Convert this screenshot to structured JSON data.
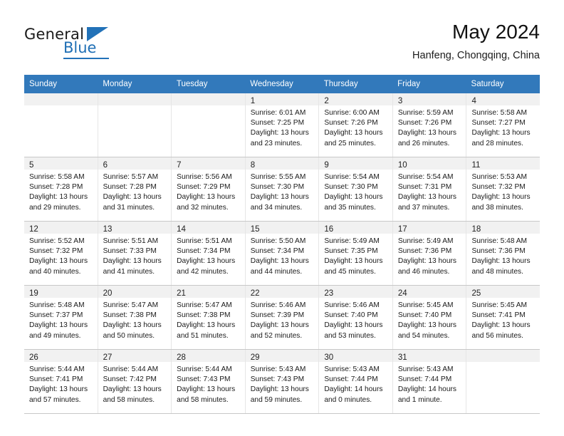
{
  "brand": {
    "name_top": "General",
    "name_bottom": "Blue",
    "accent_color": "#2272b8"
  },
  "header": {
    "title": "May 2024",
    "subtitle": "Hanfeng, Chongqing, China"
  },
  "calendar": {
    "header_bg_color": "#3279bb",
    "weekdays": [
      "Sunday",
      "Monday",
      "Tuesday",
      "Wednesday",
      "Thursday",
      "Friday",
      "Saturday"
    ],
    "weeks": [
      [
        {
          "day": "",
          "empty": true
        },
        {
          "day": "",
          "empty": true
        },
        {
          "day": "",
          "empty": true
        },
        {
          "day": "1",
          "sunrise": "Sunrise: 6:01 AM",
          "sunset": "Sunset: 7:25 PM",
          "daylight_line1": "Daylight: 13 hours",
          "daylight_line2": "and 23 minutes."
        },
        {
          "day": "2",
          "sunrise": "Sunrise: 6:00 AM",
          "sunset": "Sunset: 7:26 PM",
          "daylight_line1": "Daylight: 13 hours",
          "daylight_line2": "and 25 minutes."
        },
        {
          "day": "3",
          "sunrise": "Sunrise: 5:59 AM",
          "sunset": "Sunset: 7:26 PM",
          "daylight_line1": "Daylight: 13 hours",
          "daylight_line2": "and 26 minutes."
        },
        {
          "day": "4",
          "sunrise": "Sunrise: 5:58 AM",
          "sunset": "Sunset: 7:27 PM",
          "daylight_line1": "Daylight: 13 hours",
          "daylight_line2": "and 28 minutes."
        }
      ],
      [
        {
          "day": "5",
          "sunrise": "Sunrise: 5:58 AM",
          "sunset": "Sunset: 7:28 PM",
          "daylight_line1": "Daylight: 13 hours",
          "daylight_line2": "and 29 minutes."
        },
        {
          "day": "6",
          "sunrise": "Sunrise: 5:57 AM",
          "sunset": "Sunset: 7:28 PM",
          "daylight_line1": "Daylight: 13 hours",
          "daylight_line2": "and 31 minutes."
        },
        {
          "day": "7",
          "sunrise": "Sunrise: 5:56 AM",
          "sunset": "Sunset: 7:29 PM",
          "daylight_line1": "Daylight: 13 hours",
          "daylight_line2": "and 32 minutes."
        },
        {
          "day": "8",
          "sunrise": "Sunrise: 5:55 AM",
          "sunset": "Sunset: 7:30 PM",
          "daylight_line1": "Daylight: 13 hours",
          "daylight_line2": "and 34 minutes."
        },
        {
          "day": "9",
          "sunrise": "Sunrise: 5:54 AM",
          "sunset": "Sunset: 7:30 PM",
          "daylight_line1": "Daylight: 13 hours",
          "daylight_line2": "and 35 minutes."
        },
        {
          "day": "10",
          "sunrise": "Sunrise: 5:54 AM",
          "sunset": "Sunset: 7:31 PM",
          "daylight_line1": "Daylight: 13 hours",
          "daylight_line2": "and 37 minutes."
        },
        {
          "day": "11",
          "sunrise": "Sunrise: 5:53 AM",
          "sunset": "Sunset: 7:32 PM",
          "daylight_line1": "Daylight: 13 hours",
          "daylight_line2": "and 38 minutes."
        }
      ],
      [
        {
          "day": "12",
          "sunrise": "Sunrise: 5:52 AM",
          "sunset": "Sunset: 7:32 PM",
          "daylight_line1": "Daylight: 13 hours",
          "daylight_line2": "and 40 minutes."
        },
        {
          "day": "13",
          "sunrise": "Sunrise: 5:51 AM",
          "sunset": "Sunset: 7:33 PM",
          "daylight_line1": "Daylight: 13 hours",
          "daylight_line2": "and 41 minutes."
        },
        {
          "day": "14",
          "sunrise": "Sunrise: 5:51 AM",
          "sunset": "Sunset: 7:34 PM",
          "daylight_line1": "Daylight: 13 hours",
          "daylight_line2": "and 42 minutes."
        },
        {
          "day": "15",
          "sunrise": "Sunrise: 5:50 AM",
          "sunset": "Sunset: 7:34 PM",
          "daylight_line1": "Daylight: 13 hours",
          "daylight_line2": "and 44 minutes."
        },
        {
          "day": "16",
          "sunrise": "Sunrise: 5:49 AM",
          "sunset": "Sunset: 7:35 PM",
          "daylight_line1": "Daylight: 13 hours",
          "daylight_line2": "and 45 minutes."
        },
        {
          "day": "17",
          "sunrise": "Sunrise: 5:49 AM",
          "sunset": "Sunset: 7:36 PM",
          "daylight_line1": "Daylight: 13 hours",
          "daylight_line2": "and 46 minutes."
        },
        {
          "day": "18",
          "sunrise": "Sunrise: 5:48 AM",
          "sunset": "Sunset: 7:36 PM",
          "daylight_line1": "Daylight: 13 hours",
          "daylight_line2": "and 48 minutes."
        }
      ],
      [
        {
          "day": "19",
          "sunrise": "Sunrise: 5:48 AM",
          "sunset": "Sunset: 7:37 PM",
          "daylight_line1": "Daylight: 13 hours",
          "daylight_line2": "and 49 minutes."
        },
        {
          "day": "20",
          "sunrise": "Sunrise: 5:47 AM",
          "sunset": "Sunset: 7:38 PM",
          "daylight_line1": "Daylight: 13 hours",
          "daylight_line2": "and 50 minutes."
        },
        {
          "day": "21",
          "sunrise": "Sunrise: 5:47 AM",
          "sunset": "Sunset: 7:38 PM",
          "daylight_line1": "Daylight: 13 hours",
          "daylight_line2": "and 51 minutes."
        },
        {
          "day": "22",
          "sunrise": "Sunrise: 5:46 AM",
          "sunset": "Sunset: 7:39 PM",
          "daylight_line1": "Daylight: 13 hours",
          "daylight_line2": "and 52 minutes."
        },
        {
          "day": "23",
          "sunrise": "Sunrise: 5:46 AM",
          "sunset": "Sunset: 7:40 PM",
          "daylight_line1": "Daylight: 13 hours",
          "daylight_line2": "and 53 minutes."
        },
        {
          "day": "24",
          "sunrise": "Sunrise: 5:45 AM",
          "sunset": "Sunset: 7:40 PM",
          "daylight_line1": "Daylight: 13 hours",
          "daylight_line2": "and 54 minutes."
        },
        {
          "day": "25",
          "sunrise": "Sunrise: 5:45 AM",
          "sunset": "Sunset: 7:41 PM",
          "daylight_line1": "Daylight: 13 hours",
          "daylight_line2": "and 56 minutes."
        }
      ],
      [
        {
          "day": "26",
          "sunrise": "Sunrise: 5:44 AM",
          "sunset": "Sunset: 7:41 PM",
          "daylight_line1": "Daylight: 13 hours",
          "daylight_line2": "and 57 minutes."
        },
        {
          "day": "27",
          "sunrise": "Sunrise: 5:44 AM",
          "sunset": "Sunset: 7:42 PM",
          "daylight_line1": "Daylight: 13 hours",
          "daylight_line2": "and 58 minutes."
        },
        {
          "day": "28",
          "sunrise": "Sunrise: 5:44 AM",
          "sunset": "Sunset: 7:43 PM",
          "daylight_line1": "Daylight: 13 hours",
          "daylight_line2": "and 58 minutes."
        },
        {
          "day": "29",
          "sunrise": "Sunrise: 5:43 AM",
          "sunset": "Sunset: 7:43 PM",
          "daylight_line1": "Daylight: 13 hours",
          "daylight_line2": "and 59 minutes."
        },
        {
          "day": "30",
          "sunrise": "Sunrise: 5:43 AM",
          "sunset": "Sunset: 7:44 PM",
          "daylight_line1": "Daylight: 14 hours",
          "daylight_line2": "and 0 minutes."
        },
        {
          "day": "31",
          "sunrise": "Sunrise: 5:43 AM",
          "sunset": "Sunset: 7:44 PM",
          "daylight_line1": "Daylight: 14 hours",
          "daylight_line2": "and 1 minute."
        },
        {
          "day": "",
          "empty": true
        }
      ]
    ]
  }
}
